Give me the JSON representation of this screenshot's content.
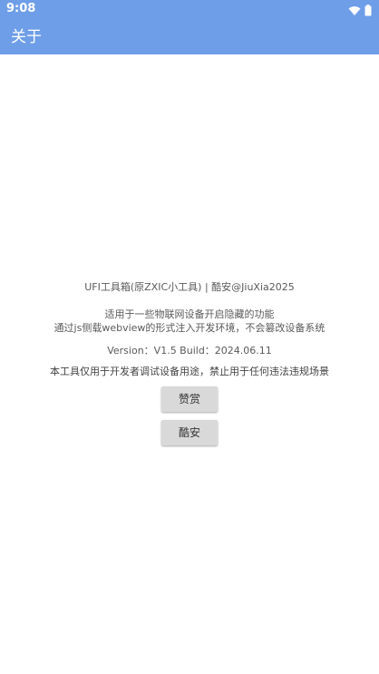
{
  "status_bar": {
    "time": "9:08",
    "icons": [
      "wifi-icon",
      "battery-icon"
    ]
  },
  "app_bar": {
    "title": "关于"
  },
  "about": {
    "title_line": "UFI工具箱(原ZXIC小工具)  |  酷安@JiuXia2025",
    "desc_line1": "适用于一些物联网设备开启隐藏的功能",
    "desc_line2": "通过js侧载webview的形式注入开发环境，不会篡改设备系统",
    "version_line": "Version：V1.5  Build：2024.06.11",
    "notice_line": "本工具仅用于开发者调试设备用途，禁止用于任何违法违规场景"
  },
  "buttons": {
    "appreciate_label": "赞赏",
    "coolapk_label": "酷安"
  },
  "colors": {
    "accent": "#6f9ee8",
    "button_bg": "#d9d9d9",
    "text": "#5a5a5a"
  }
}
